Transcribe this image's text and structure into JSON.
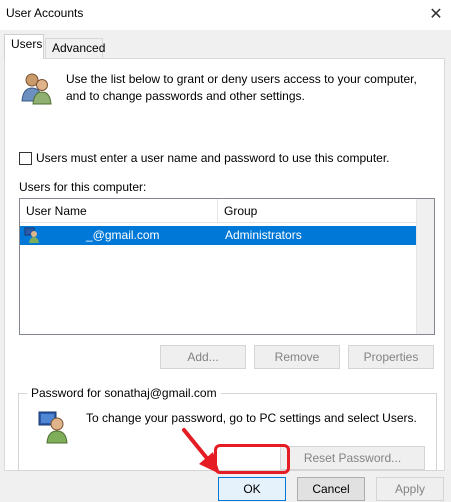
{
  "window": {
    "title": "User Accounts",
    "close_glyph": "✕"
  },
  "tabs": [
    {
      "label": "Users",
      "active": true
    },
    {
      "label": "Advanced",
      "active": false
    }
  ],
  "intro": {
    "icon": "users-icon",
    "text": "Use the list below to grant or deny users access to your computer, and to change passwords and other settings."
  },
  "require_password": {
    "label": "Users must enter a user name and password to use this computer.",
    "checked": false
  },
  "users_list": {
    "label": "Users for this computer:",
    "columns": [
      "User Name",
      "Group"
    ],
    "rows": [
      {
        "user": "_@gmail.com",
        "group": "Administrators",
        "selected": true,
        "icon": "user-icon"
      }
    ]
  },
  "list_buttons": {
    "add": "Add...",
    "remove": "Remove",
    "properties": "Properties"
  },
  "password_group": {
    "title": "Password for sonathaj@gmail.com",
    "icon": "user-password-icon",
    "text": "To change your password, go to PC settings and select Users.",
    "reset_button": "Reset Password..."
  },
  "dialog_buttons": {
    "ok": "OK",
    "cancel": "Cancel",
    "apply": "Apply"
  },
  "colors": {
    "selection": "#0078d7",
    "annotation": "#e51c23"
  }
}
